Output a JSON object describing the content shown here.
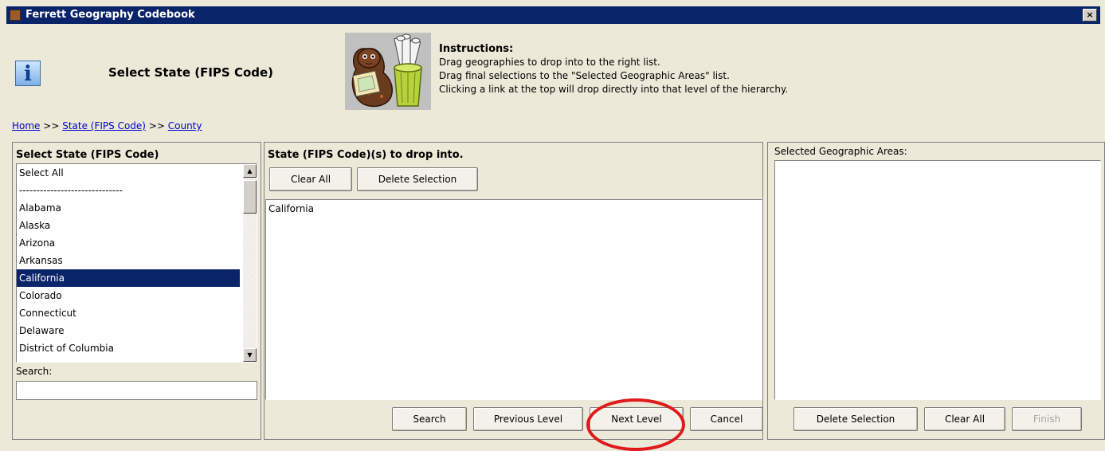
{
  "window": {
    "title": "Ferrett Geography Codebook",
    "close_label": "×"
  },
  "header": {
    "page_title": "Select State (FIPS Code)",
    "info_icon_glyph": "i",
    "instructions": {
      "heading": "Instructions:",
      "lines": [
        "Drag geographies to drop into to the right list.",
        "Drag final selections to the \"Selected Geographic Areas\" list.",
        "Clicking a link at the top will drop directly into that level of the hierarchy."
      ]
    }
  },
  "breadcrumb": {
    "home": "Home",
    "sep": ">>",
    "state": "State (FIPS Code)",
    "county": "County"
  },
  "left_panel": {
    "title": "Select State (FIPS Code)",
    "items": [
      "Select All",
      "------------------------------",
      "Alabama",
      "Alaska",
      "Arizona",
      "Arkansas",
      "California",
      "Colorado",
      "Connecticut",
      "Delaware",
      "District of Columbia"
    ],
    "selected_item": "California",
    "search_label": "Search:",
    "search_value": ""
  },
  "middle_panel": {
    "title": "State (FIPS Code)(s) to drop into.",
    "clear_all_label": "Clear All",
    "delete_selection_label": "Delete Selection",
    "items": [
      "California"
    ]
  },
  "right_panel": {
    "title": "Selected Geographic Areas:",
    "items": []
  },
  "bottom_buttons": {
    "search": "Search",
    "previous_level": "Previous Level",
    "next_level": "Next Level",
    "cancel": "Cancel",
    "delete_selection": "Delete Selection",
    "clear_all": "Clear All",
    "finish": "Finish"
  },
  "colors": {
    "title_bar": "#0a246a",
    "window_bg": "#ece9d8",
    "selection": "#0a246a",
    "link": "#0000cc",
    "annotation_circle": "#e0191c"
  }
}
